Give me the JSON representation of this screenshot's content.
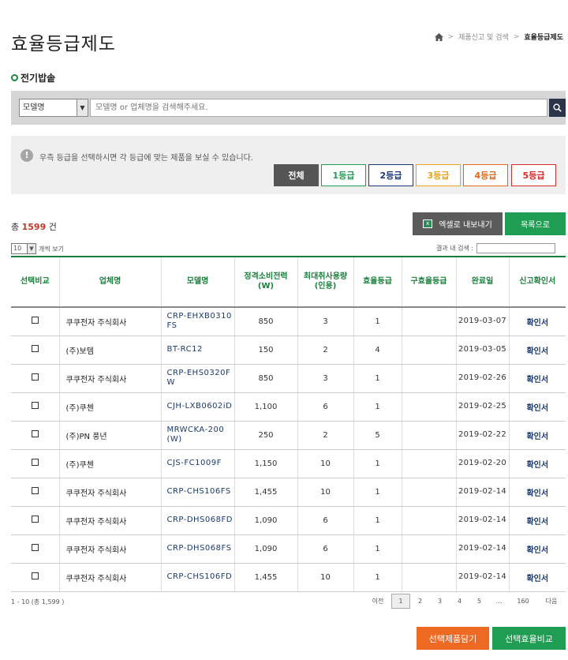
{
  "header": {
    "title": "효율등급제도",
    "breadcrumb": [
      ">",
      "제품신고 및 검색",
      ">",
      "효율등급제도"
    ]
  },
  "section": {
    "title": "전기밥솥"
  },
  "search": {
    "select_value": "모델명",
    "placeholder": "모델명 or 업체명을 검색해주세요."
  },
  "grade_filter": {
    "message": "우측 등급을 선택하시면 각 등급에 맞는 제품을 보실 수 있습니다.",
    "buttons": [
      {
        "label": "전체",
        "color": "#555555"
      },
      {
        "label": "1등급",
        "color": "#1f9d52"
      },
      {
        "label": "2등급",
        "color": "#1a3a7e"
      },
      {
        "label": "3등급",
        "color": "#e8a317"
      },
      {
        "label": "4등급",
        "color": "#e06a1a"
      },
      {
        "label": "5등급",
        "color": "#d62b2b"
      }
    ]
  },
  "summary": {
    "prefix": "총",
    "count": "1599",
    "suffix": "건",
    "excel_label": "엑셀로 내보내기",
    "list_label": "목록으로"
  },
  "table_tools": {
    "per_page_value": "10",
    "per_page_label": "개씩 보기",
    "in_search_label": "결과 내 검색 :"
  },
  "table": {
    "headers": [
      "선택비교",
      "업체명",
      "모델명",
      "정격소비전력(W)",
      "최대취사용량(인용)",
      "효율등급",
      "구효율등급",
      "완료일",
      "신고확인서"
    ],
    "rows": [
      {
        "company": "쿠쿠전자 주식회사",
        "model": "CRP-EHXB0310FS",
        "power": "850",
        "capacity": "3",
        "grade": "1",
        "old_grade": "",
        "date": "2019-03-07",
        "cert": "확인서"
      },
      {
        "company": "(주)보템",
        "model": "BT-RC12",
        "power": "150",
        "capacity": "2",
        "grade": "4",
        "old_grade": "",
        "date": "2019-03-05",
        "cert": "확인서"
      },
      {
        "company": "쿠쿠전자 주식회사",
        "model": "CRP-EHS0320FW",
        "power": "850",
        "capacity": "3",
        "grade": "1",
        "old_grade": "",
        "date": "2019-02-26",
        "cert": "확인서"
      },
      {
        "company": "(주)쿠첸",
        "model": "CJH-LXB0602iD",
        "power": "1,100",
        "capacity": "6",
        "grade": "1",
        "old_grade": "",
        "date": "2019-02-25",
        "cert": "확인서"
      },
      {
        "company": "(주)PN 풍년",
        "model": "MRWCKA-200(W)",
        "power": "250",
        "capacity": "2",
        "grade": "5",
        "old_grade": "",
        "date": "2019-02-22",
        "cert": "확인서"
      },
      {
        "company": "(주)쿠첸",
        "model": "CJS-FC1009F",
        "power": "1,150",
        "capacity": "10",
        "grade": "1",
        "old_grade": "",
        "date": "2019-02-20",
        "cert": "확인서"
      },
      {
        "company": "쿠쿠전자 주식회사",
        "model": "CRP-CHS106FS",
        "power": "1,455",
        "capacity": "10",
        "grade": "1",
        "old_grade": "",
        "date": "2019-02-14",
        "cert": "확인서"
      },
      {
        "company": "쿠쿠전자 주식회사",
        "model": "CRP-DHS068FD",
        "power": "1,090",
        "capacity": "6",
        "grade": "1",
        "old_grade": "",
        "date": "2019-02-14",
        "cert": "확인서"
      },
      {
        "company": "쿠쿠전자 주식회사",
        "model": "CRP-DHS068FS",
        "power": "1,090",
        "capacity": "6",
        "grade": "1",
        "old_grade": "",
        "date": "2019-02-14",
        "cert": "확인서"
      },
      {
        "company": "쿠쿠전자 주식회사",
        "model": "CRP-CHS106FD",
        "power": "1,455",
        "capacity": "10",
        "grade": "1",
        "old_grade": "",
        "date": "2019-02-14",
        "cert": "확인서"
      }
    ]
  },
  "pagination": {
    "range_text": "1 - 10 (총 1,599 )",
    "prev": "이전",
    "pages": [
      "1",
      "2",
      "3",
      "4",
      "5",
      "…",
      "160"
    ],
    "next": "다음"
  },
  "actions": {
    "add_label": "선택제품담기",
    "compare_label": "선택효율비교",
    "add_color": "#ee6a23",
    "compare_color": "#1f9d52"
  }
}
